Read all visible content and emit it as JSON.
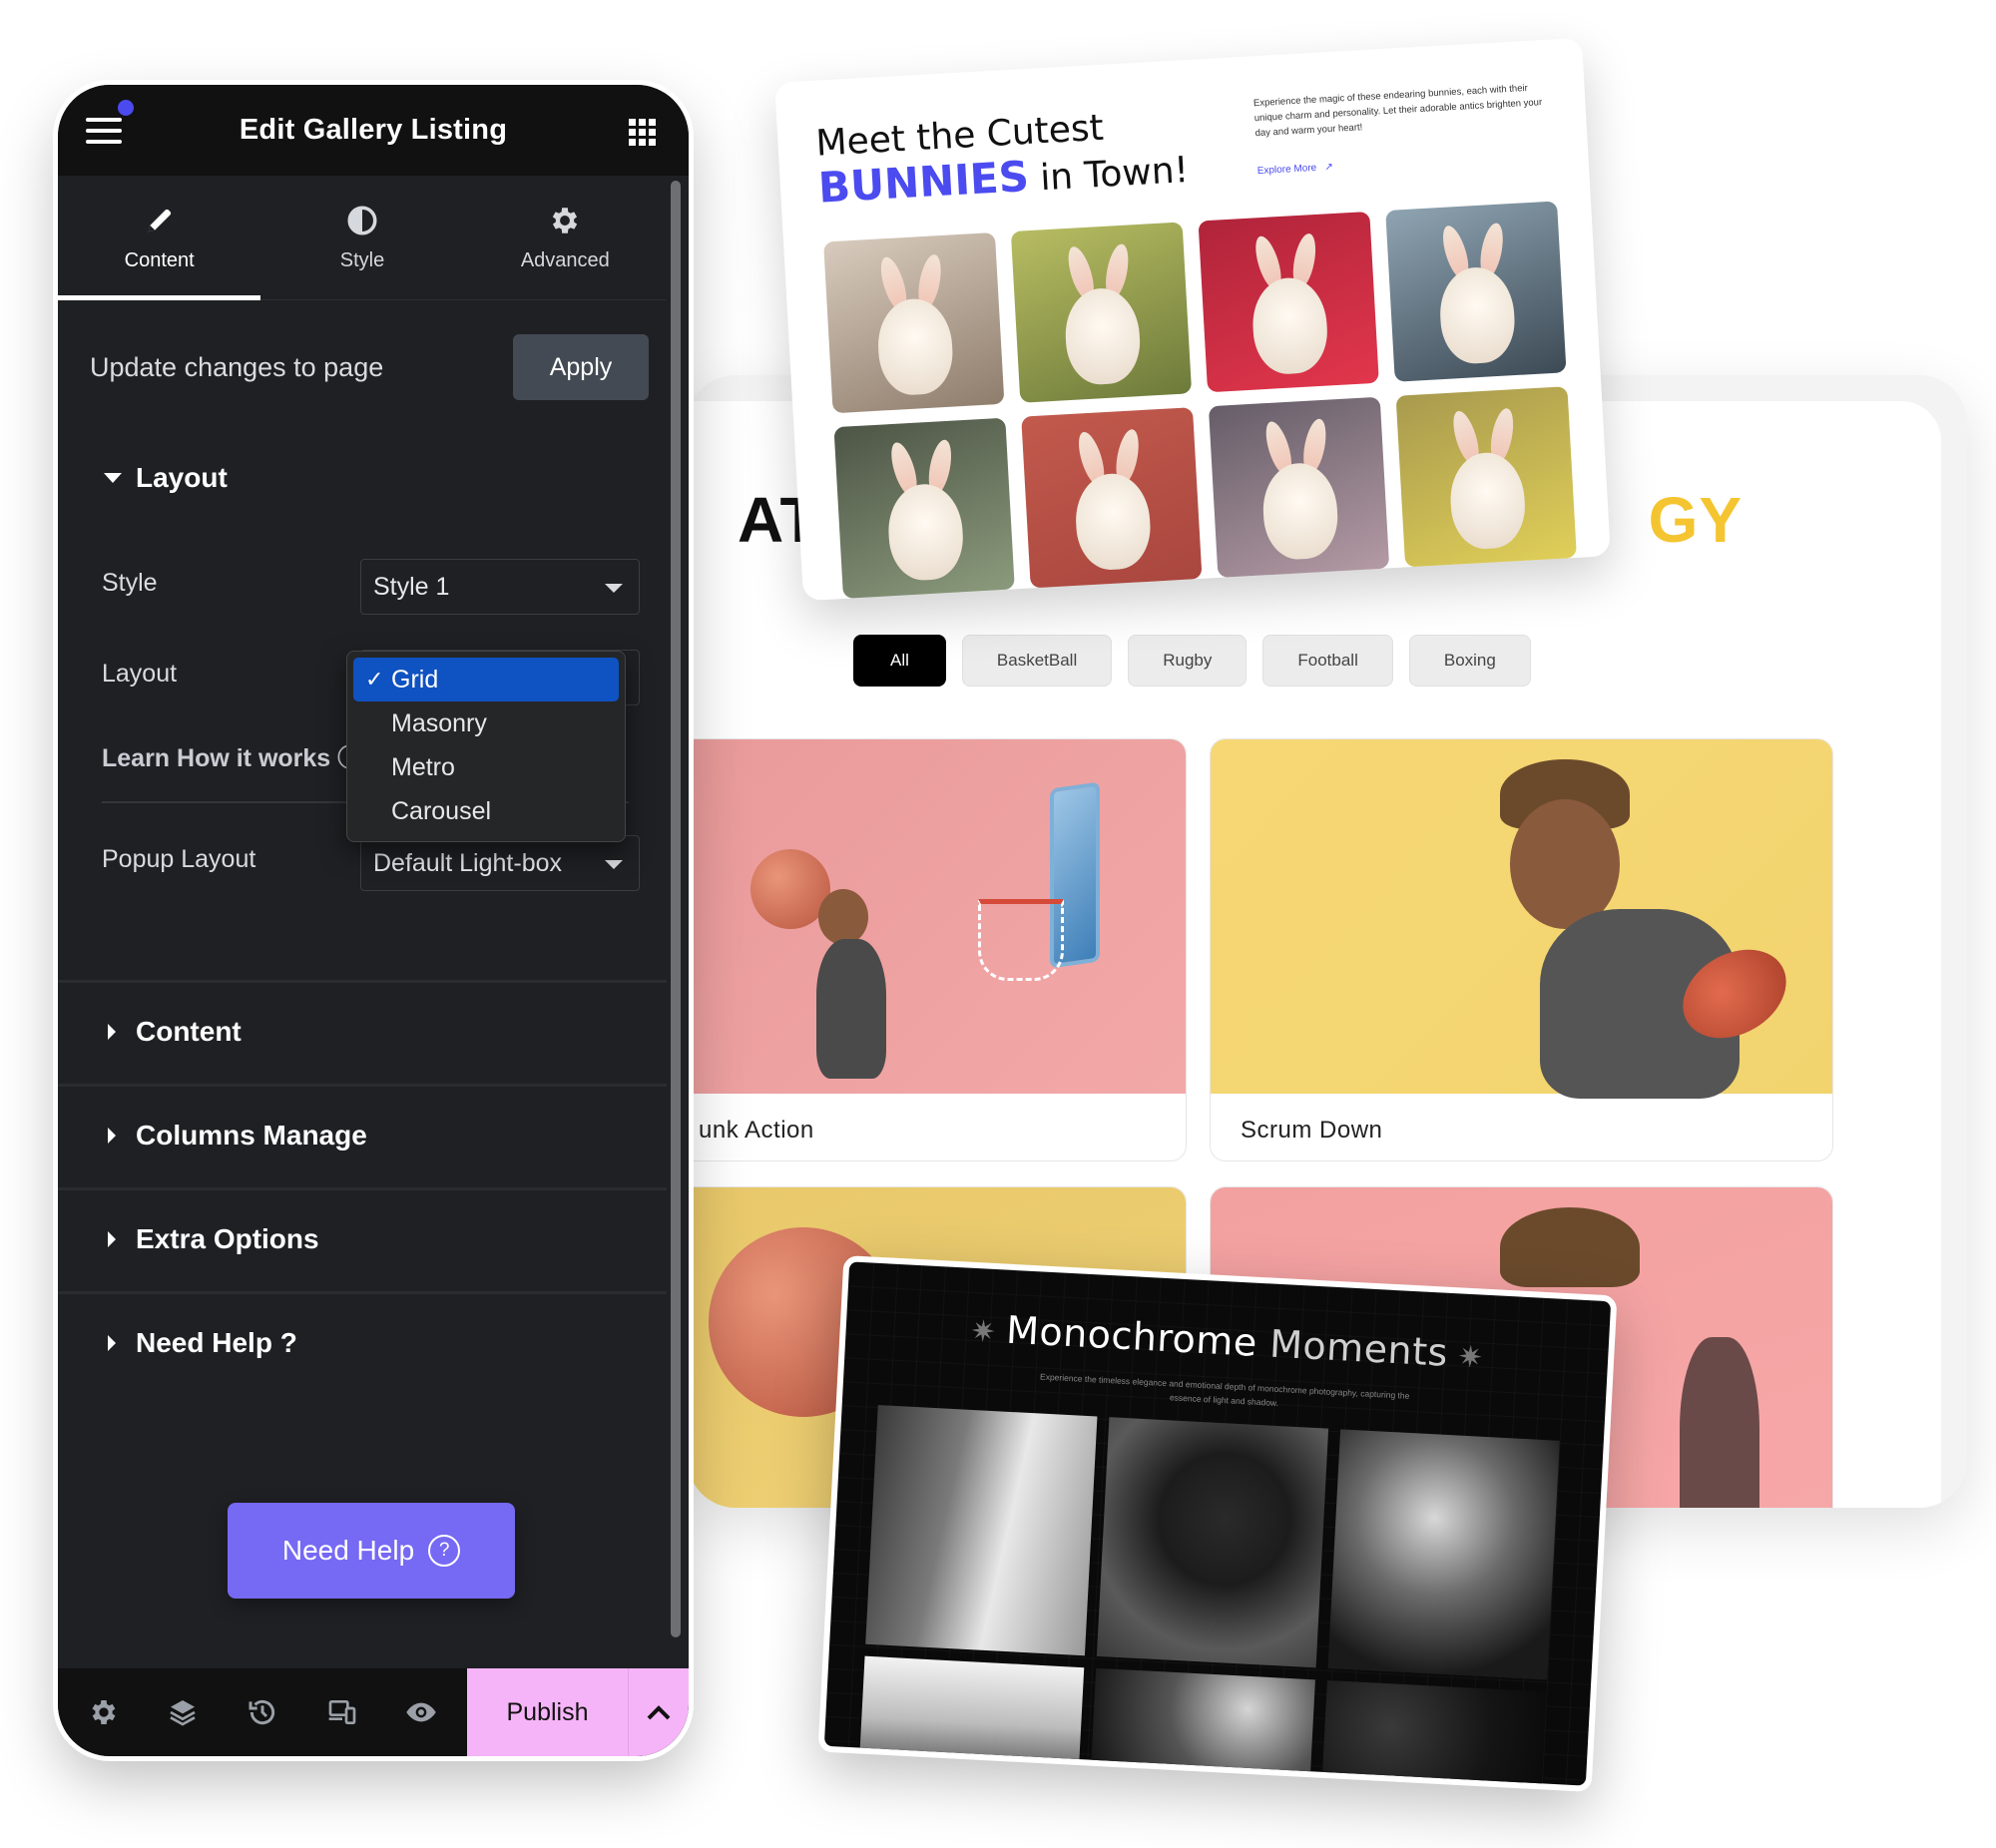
{
  "back_preview": {
    "title_start": "AT",
    "title_end": "GY",
    "filters": [
      "All",
      "BasketBall",
      "Rugby",
      "Football",
      "Boxing"
    ],
    "active_filter": "All",
    "cards": [
      {
        "caption": "unk Action"
      },
      {
        "caption": "Scrum Down"
      },
      {
        "caption": ""
      },
      {
        "caption": ""
      }
    ],
    "accent_color": "#f4c531"
  },
  "bunnies_card": {
    "title_line1": "Meet the Cutest",
    "title_highlight": "BUNNIES",
    "title_line2_rest": " in Town!",
    "description": "Experience the magic of these endearing bunnies, each with their unique charm and personality. Let their adorable antics brighten your day and warm your heart!",
    "link_label": "Explore More",
    "link_icon": "arrow-up-right-icon",
    "highlight_color": "#4b4bf0",
    "tiles": [
      {
        "bg": "linear-gradient(160deg,#d8cbbd,#8f7d6c)"
      },
      {
        "bg": "linear-gradient(160deg,#b8bd62,#6d7a3a)"
      },
      {
        "bg": "linear-gradient(160deg,#b0243a,#e2364c)"
      },
      {
        "bg": "linear-gradient(160deg,#8fa4b2,#3c4a55)"
      },
      {
        "bg": "linear-gradient(160deg,#4d5546,#8b9a7c)"
      },
      {
        "bg": "linear-gradient(160deg,#c25a4d,#a9463e)"
      },
      {
        "bg": "linear-gradient(160deg,#655d68,#b49aa4)"
      },
      {
        "bg": "linear-gradient(160deg,#a89a4e,#e0cf58)"
      }
    ]
  },
  "mono_card": {
    "title_a": "Monochrome",
    "title_b": "Moments",
    "star": "✷",
    "subtitle": "Experience the timeless elegance and emotional depth of monochrome photography, capturing the essence of light and shadow."
  },
  "panel": {
    "title": "Edit Gallery Listing",
    "tabs": [
      {
        "label": "Content",
        "icon": "pencil-icon",
        "active": true
      },
      {
        "label": "Style",
        "icon": "contrast-icon",
        "active": false
      },
      {
        "label": "Advanced",
        "icon": "gear-icon",
        "active": false
      }
    ],
    "apply_label": "Update changes to page",
    "apply_button": "Apply",
    "layout_section": "Layout",
    "fields": {
      "style_label": "Style",
      "style_value": "Style 1",
      "layout_label": "Layout",
      "layout_value": "Grid",
      "learn_label": "Learn How it works",
      "popup_label": "Popup Layout",
      "popup_value": "Default Light-box"
    },
    "layout_options": [
      {
        "label": "Grid",
        "selected": true
      },
      {
        "label": "Masonry",
        "selected": false
      },
      {
        "label": "Metro",
        "selected": false
      },
      {
        "label": "Carousel",
        "selected": false
      }
    ],
    "check_mark": "✓",
    "collapsed_sections": [
      "Content",
      "Columns Manage",
      "Extra Options",
      "Need Help ?"
    ],
    "help_button": "Need Help",
    "help_icon_glyph": "?",
    "footer": {
      "icons": [
        "settings-icon",
        "layers-icon",
        "history-icon",
        "responsive-icon",
        "preview-eye-icon"
      ],
      "publish_label": "Publish"
    },
    "colors": {
      "publish_bg": "#f6b4f8",
      "help_bg": "#7669f3",
      "dropdown_selected": "#0f52c1",
      "notification_dot": "#4a4aee"
    }
  }
}
